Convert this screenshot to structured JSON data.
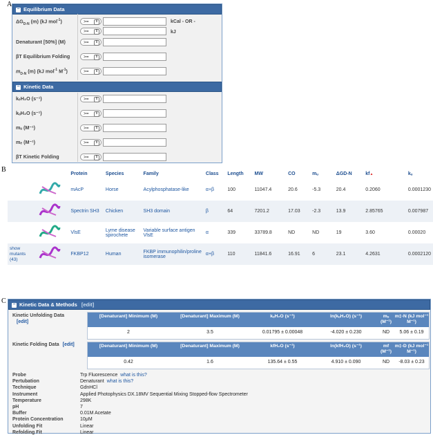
{
  "panel_labels": {
    "a": "A",
    "b": "B",
    "c": "C"
  },
  "equilibrium": {
    "title": "Equilibrium Data",
    "fields": [
      {
        "label": "ΔG",
        "sub": "D-N",
        "suffix": " (m) (kJ mol",
        "sup": "-1",
        "end": ")"
      },
      {
        "label": "Denaturant [50%] (M)"
      },
      {
        "label": "βT Equilibrium Folding"
      },
      {
        "label": "m",
        "sub": "D-N",
        "suffix": " (m) (kJ mol",
        "sup": "-1",
        "end": " M",
        "sup2": "-1",
        "end2": ")"
      }
    ],
    "units": {
      "kcal": "kCal  - OR -",
      "kj": "kJ"
    },
    "operator": ">="
  },
  "kinetic": {
    "title": "Kinetic Data",
    "fields": [
      "kₑH₂O (s⁻¹)",
      "kᵤH₂O (s⁻¹)",
      "mᵤ (M⁻¹)",
      "mₑ (M⁻¹)",
      "βT Kinetic Folding"
    ],
    "operator": ">="
  },
  "proteins": {
    "headers": [
      "Protein",
      "Species",
      "Family",
      "Class",
      "Length",
      "MW",
      "CO",
      "mᵤ",
      "ΔGD-N",
      "kf",
      "kᵤ"
    ],
    "rows": [
      {
        "show": "",
        "protein": "mAcP",
        "species": "Horse",
        "family": "Acylphosphatase-like",
        "class": "α+β",
        "length": "100",
        "mw": "11047.4",
        "co": "20.6",
        "mu": "-5.3",
        "dg": "20.4",
        "kf": "0.2060",
        "ku": "0.0001230"
      },
      {
        "show": "",
        "protein": "Spectrin SH3",
        "species": "Chicken",
        "family": "SH3 domain",
        "class": "β",
        "length": "64",
        "mw": "7201.2",
        "co": "17.03",
        "mu": "-2.3",
        "dg": "13.9",
        "kf": "2.85765",
        "ku": "0.007987"
      },
      {
        "show": "",
        "protein": "VlsE",
        "species": "Lyme disease spirochete",
        "family": "Variable surface antigen VlsE",
        "class": "α",
        "length": "339",
        "mw": "33789.8",
        "co": "ND",
        "mu": "ND",
        "dg": "19",
        "kf": "3.60",
        "ku": "0.00020"
      },
      {
        "show": "show mutants (43)",
        "protein": "FKBP12",
        "species": "Human",
        "family": "FKBP immunophilin/proline isomerase",
        "class": "α+β",
        "length": "110",
        "mw": "11841.6",
        "co": "16.91",
        "mu": "6",
        "dg": "23.1",
        "kf": "4.2631",
        "ku": "0.0002120"
      }
    ]
  },
  "methods": {
    "title": "Kinetic Data & Methods",
    "edit": "[edit]",
    "unfolding": {
      "label": "Kinetic Unfolding Data",
      "edit": "[edit]",
      "headers": [
        "[Denaturant] Minimum (M)",
        "[Denaturant] Maximum (M)",
        "kᵤH₂O (s⁻¹)",
        "ln(kᵤH₂O) (s⁻¹)",
        "mᵤ (M⁻¹)",
        "m‡-N (kJ mol⁻¹ M⁻¹)"
      ],
      "values": [
        "2",
        "3.5",
        "0.01795 ± 0.00048",
        "-4.020 ± 0.230",
        "ND",
        "5.06 ± 0.19"
      ]
    },
    "folding": {
      "label": "Kinetic Folding Data",
      "edit": "[edit]",
      "headers": [
        "[Denaturant] Minimum (M)",
        "[Denaturant] Maximum (M)",
        "kfH₂O (s⁻¹)",
        "ln(kfH₂O) (s⁻¹)",
        "mf (M⁻¹)",
        "m‡-D (kJ mol⁻¹ M⁻¹)"
      ],
      "values": [
        "0.42",
        "1.6",
        "135.64 ± 0.55",
        "4.910 ± 0.090",
        "ND",
        "-8.03 ± 0.23"
      ]
    },
    "props": [
      {
        "label": "Probe",
        "value": "Trp Fluorescence",
        "link": "what is this?"
      },
      {
        "label": "Pertubation",
        "value": "Denaturant",
        "link": "what is this?"
      },
      {
        "label": "Technique",
        "value": "GdnHCl"
      },
      {
        "label": "Instrument",
        "value": "Applied Photophysics DX.18MV Sequential Mixing Stopped-flow Spectrometer"
      },
      {
        "label": "Temperature",
        "value": "298K"
      },
      {
        "label": "pH",
        "value": "7"
      },
      {
        "label": "Buffer",
        "value": "0.01M Acetate"
      },
      {
        "label": "Protein Concentration",
        "value": "10μM"
      },
      {
        "label": "Unfolding Fit",
        "value": "Linear"
      },
      {
        "label": "Refolding Fit",
        "value": "Linear"
      }
    ]
  }
}
